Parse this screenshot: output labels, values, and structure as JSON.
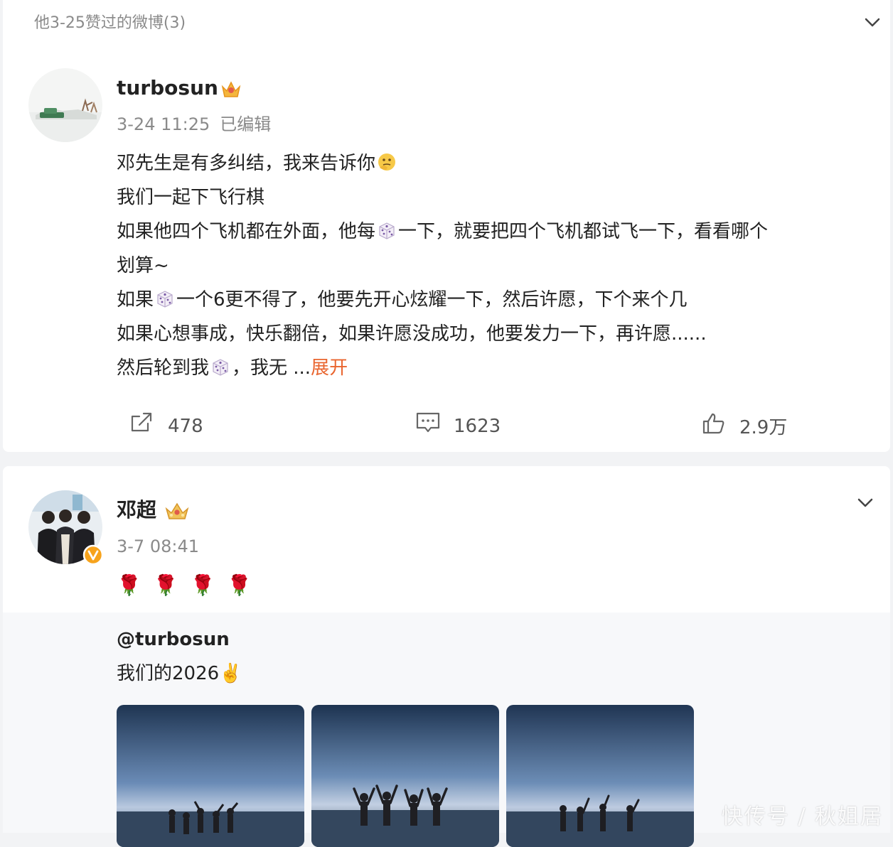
{
  "section": {
    "title": "他3-25赞过的微博(3)"
  },
  "post1": {
    "username": "turbosun",
    "time": "3-24 11:25",
    "edited": "已编辑",
    "lines": [
      "邓先生是有多纠结，我来告诉你",
      "我们一起下飞行棋",
      "如果他四个飞机都在外面，他每",
      "一下，就要把四个飞机都试飞一下，看看哪个",
      "划算~",
      "如果",
      "一个6更不得了，他要先开心炫耀一下，然后许愿，下个来个几",
      "如果心想事成，快乐翻倍，如果许愿没成功，他要发力一下，再许愿......",
      "然后轮到我",
      "，我无 ..."
    ],
    "expand": "展开",
    "actions": {
      "repost": "478",
      "comment": "1623",
      "like": "2.9万"
    }
  },
  "post2": {
    "username": "邓超",
    "time": "3-7 08:41",
    "emoji_row": "🌹 🌹 🌹 🌹",
    "repost": {
      "user": "@turbosun",
      "text": "我们的2026✌️"
    }
  },
  "watermark": "快传号 / 秋姐居",
  "colors": {
    "accent": "#e9652f",
    "muted": "#8a8a8a",
    "background": "#f2f3f5"
  }
}
